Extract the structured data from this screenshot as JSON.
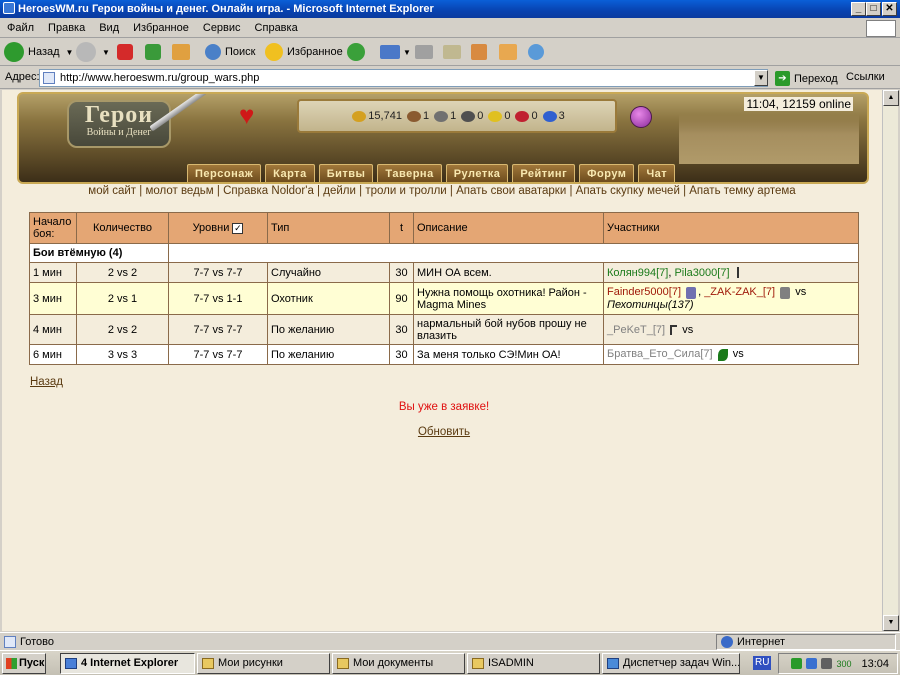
{
  "window": {
    "title": "HeroesWM.ru Герои войны и денег. Онлайн игра. - Microsoft Internet Explorer",
    "btn_min": "_",
    "btn_max": "□",
    "btn_close": "✕"
  },
  "menu": [
    "Файл",
    "Правка",
    "Вид",
    "Избранное",
    "Сервис",
    "Справка"
  ],
  "toolbar": {
    "back": "Назад",
    "search": "Поиск",
    "favorites": "Избранное"
  },
  "address": {
    "label": "Адрес:",
    "url": "http://www.heroeswm.ru/group_wars.php",
    "go": "Переход",
    "links": "Ссылки"
  },
  "game": {
    "clock": "11:04, 12159 online",
    "logo_title": "Герои",
    "logo_sub": "Войны и Денег",
    "resources": [
      {
        "icon": "gold-icon",
        "value": "15,741",
        "color": "#d4a020"
      },
      {
        "icon": "wood-icon",
        "value": "1",
        "color": "#8a5a30"
      },
      {
        "icon": "ore-icon",
        "value": "1",
        "color": "#707070"
      },
      {
        "icon": "mercury-icon",
        "value": "0",
        "color": "#505050"
      },
      {
        "icon": "sulfur-icon",
        "value": "0",
        "color": "#e0c020"
      },
      {
        "icon": "crystal-icon",
        "value": "0",
        "color": "#c02030"
      },
      {
        "icon": "gems-icon",
        "value": "3",
        "color": "#3060d0"
      }
    ],
    "nav": [
      "Персонаж",
      "Карта",
      "Битвы",
      "Таверна",
      "Рулетка",
      "Рейтинг",
      "Форум",
      "Чат"
    ],
    "sublinks": [
      "мой сайт",
      "молот ведьм",
      "Справка Noldor'a",
      "дейли",
      "троли и тролли",
      "Апать свои аватарки",
      "Апать скупку мечей",
      "Апать темку артема"
    ]
  },
  "table": {
    "headers": {
      "start": "Начало боя:",
      "count": "Количество",
      "levels": "Уровни",
      "type": "Тип",
      "t": "t",
      "desc": "Описание",
      "participants": "Участники"
    },
    "section": "Бои втёмную (4)",
    "rows": [
      {
        "start": "1 мин",
        "count": "2 vs 2",
        "levels": "7-7 vs 7-7",
        "type": "Случайно",
        "t": "30",
        "desc": "МИН ОА всем.",
        "p1": "Колян994[7]",
        "sep": ",",
        "p2": "Pila3000[7]",
        "vs": "",
        "extra": ""
      },
      {
        "start": "3 мин",
        "count": "2 vs 1",
        "levels": "7-7 vs 1-1",
        "type": "Охотник",
        "t": "90",
        "desc": "Нужна помощь охотника! Район - Magma Mines",
        "p1": "Fainder5000[7]",
        "sep": ",",
        "p2": "_ZAK-ZAK_[7]",
        "vs": "vs",
        "extra": "Пехотинцы(137)"
      },
      {
        "start": "4 мин",
        "count": "2 vs 2",
        "levels": "7-7 vs 7-7",
        "type": "По желанию",
        "t": "30",
        "desc": "нармальный бой нубов прошу не влазить",
        "p1": "_PeKeT_[7]",
        "sep": "",
        "p2": "",
        "vs": "vs",
        "extra": ""
      },
      {
        "start": "6 мин",
        "count": "3 vs 3",
        "levels": "7-7 vs 7-7",
        "type": "По желанию",
        "t": "30",
        "desc": "За меня только СЭ!Мин ОА!",
        "p1": "Братва_Ето_Сила[7]",
        "sep": "",
        "p2": "",
        "vs": "vs",
        "extra": ""
      }
    ]
  },
  "back_link": "Назад",
  "message": "Вы уже в заявке!",
  "refresh_link": "Обновить",
  "status": {
    "left": "Готово",
    "zone": "Интернет"
  },
  "taskbar": {
    "start": "Пуск",
    "tasks": [
      "4 Internet Explorer",
      "Мои рисунки",
      "Мои документы",
      "ISADMIN",
      "Диспетчер задач Win..."
    ],
    "lang": "RU",
    "time": "13:04",
    "tray_num": "300"
  }
}
